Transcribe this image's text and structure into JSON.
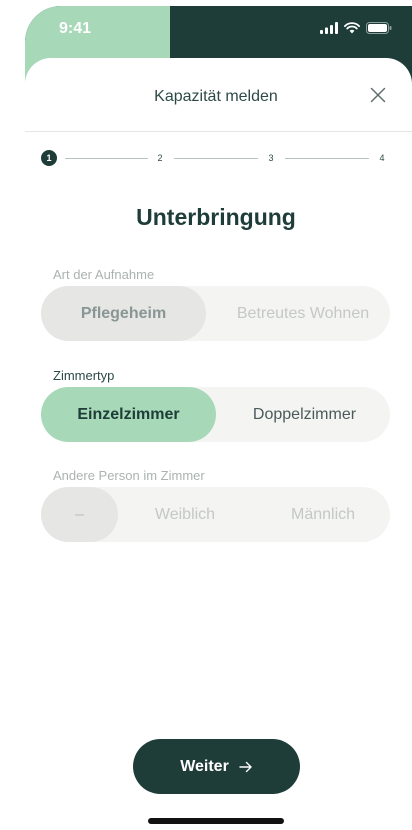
{
  "status_bar": {
    "time": "9:41"
  },
  "sheet": {
    "title": "Kapazität melden"
  },
  "stepper": {
    "steps": [
      "1",
      "2",
      "3",
      "4"
    ],
    "current": 1
  },
  "page": {
    "heading": "Unterbringung"
  },
  "art_der_aufnahme": {
    "label": "Art der Aufnahme",
    "options": [
      "Pflegeheim",
      "Betreutes Wohnen"
    ],
    "selected": "Pflegeheim"
  },
  "zimmertyp": {
    "label": "Zimmertyp",
    "options": [
      "Einzelzimmer",
      "Doppelzimmer"
    ],
    "selected": "Einzelzimmer"
  },
  "andere_person": {
    "label": "Andere Person im Zimmer",
    "options": [
      "–",
      "Weiblich",
      "Männlich"
    ],
    "selected": "–"
  },
  "footer": {
    "next_label": "Weiter",
    "next_icon": "arrow-right-icon"
  },
  "colors": {
    "dark": "#1e3c38",
    "accent_green": "#a7d8b8",
    "segment_bg": "#f4f4f3"
  }
}
